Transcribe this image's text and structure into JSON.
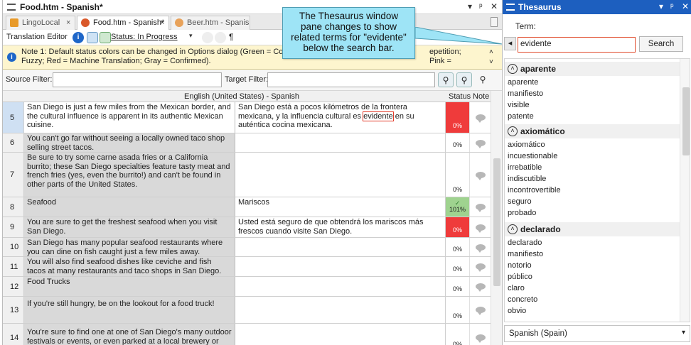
{
  "editor": {
    "title": "Food.htm - Spanish*",
    "window_controls": [
      "▾",
      "ᵖ",
      "✕"
    ],
    "tabs": [
      {
        "label": "LingoLocal",
        "close": "×"
      },
      {
        "label": "Food.htm - Spanish*",
        "close": "×"
      },
      {
        "label": "Beer.htm - Spanish"
      }
    ],
    "toolbar": {
      "label": "Translation Editor",
      "status_link": "Status: In Progress"
    },
    "note": "Note 1: Default status colors can be changed in Options dialog (Green = Confirmed; Pink = Repetition; Pink = Fuzzy; Red = Machine Translation; Gray = Confirmed).",
    "note_visible_a": "Note 1: Default status colors can be changed in Options dialog (Green = Cor",
    "note_visible_b": "epetition; Pink =",
    "note_visible_c": "Fuzzy; Red = Machine Translation; Gray = Confirmed).",
    "source_filter_label": "Source Filter:",
    "target_filter_label": "Target Filter:",
    "grid_header": {
      "lang": "English (United States) - Spanish",
      "status": "Status",
      "note": "Note"
    },
    "rows": [
      {
        "n": "5",
        "src": "San Diego is just a few miles from the Mexican border, and the cultural influence is apparent in its authentic Mexican cuisine.",
        "tgt_a": "San Diego está a pocos kilómetros de la frontera mexicana, y la influencia cultural es ",
        "tgt_hl": "evidente",
        "tgt_b": " en su auténtica cocina mexicana.",
        "status": "0%"
      },
      {
        "n": "6",
        "src": "You can't go far without seeing a locally owned taco shop selling street tacos.",
        "tgt": "",
        "status": "0%"
      },
      {
        "n": "7",
        "src": "Be sure to try some carne asada fries or a California burrito; these San Diego specialties feature tasty meat and french fries (yes, even the burrito!) and can't be found in other parts of the United States.",
        "tgt": "",
        "status": "0%"
      },
      {
        "n": "8",
        "src": "Seafood",
        "tgt": "Mariscos",
        "status": "101%"
      },
      {
        "n": "9",
        "src": "You are sure to get the freshest seafood when you visit San Diego.",
        "tgt": "Usted está seguro de que obtendrá los mariscos más frescos cuando visite San Diego.",
        "status": "0%"
      },
      {
        "n": "10",
        "src": "San Diego has many popular seafood restaurants where you can dine on fish caught just a few miles away.",
        "tgt": "",
        "status": "0%"
      },
      {
        "n": "11",
        "src": "You will also find seafood dishes like ceviche and fish tacos at many restaurants and taco shops in San Diego.",
        "tgt": "",
        "status": "0%"
      },
      {
        "n": "12",
        "src": "Food Trucks",
        "tgt": "",
        "status": "0%"
      },
      {
        "n": "13",
        "src": "If you're still hungry, be on the lookout for a food truck!",
        "tgt": "",
        "status": "0%"
      },
      {
        "n": "14",
        "src": "You're sure to find one at one of San Diego's many outdoor festivals or events, or even parked at a local brewery or",
        "tgt": "",
        "status": "0%"
      }
    ]
  },
  "callout": "The Thesaurus window pane changes to show related terms for \"evidente\" below the search bar.",
  "thesaurus": {
    "title": "Thesaurus",
    "controls": [
      "▾",
      "ᵖ",
      "✕"
    ],
    "term_label": "Term:",
    "term_value": "evidente",
    "search_label": "Search",
    "groups": [
      {
        "head": "aparente",
        "items": [
          "aparente",
          "manifiesto",
          "visible",
          "patente"
        ]
      },
      {
        "head": "axiomático",
        "items": [
          "axiomático",
          "incuestionable",
          "irrebatible",
          "indiscutible",
          "incontrovertible",
          "seguro",
          "probado"
        ]
      },
      {
        "head": "declarado",
        "items": [
          "declarado",
          "manifiesto",
          "notorio",
          "público",
          "claro",
          "concreto",
          "obvio"
        ]
      }
    ],
    "language": "Spanish (Spain)"
  },
  "colors": {
    "mt_red": "#ef3b3b",
    "confirmed_green": "#9fd38f",
    "accent": "#1d5fbf"
  }
}
